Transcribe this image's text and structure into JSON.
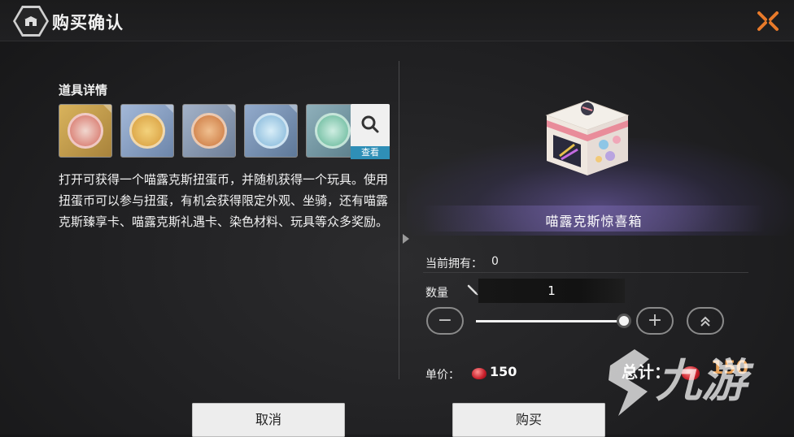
{
  "header": {
    "title": "购买确认",
    "close_icon": "close-x-icon",
    "badge_icon": "shop-icon"
  },
  "details": {
    "label": "道具详情",
    "items": [
      {
        "name": "red-token",
        "color": "#c9a04a",
        "inner": "#e07a6a"
      },
      {
        "name": "gold-coin",
        "color": "#8fa7c9",
        "inner": "#e4b24e"
      },
      {
        "name": "orange-coin",
        "color": "#8f9fb8",
        "inner": "#d69047"
      },
      {
        "name": "blue-coin",
        "color": "#7b96b8",
        "inner": "#8fc0e0"
      },
      {
        "name": "teal-coin",
        "color": "#7a9aa6",
        "inner": "#75c2a8"
      }
    ],
    "search_label": "查看",
    "description": "打开可获得一个喵露克斯扭蛋币，并随机获得一个玩具。使用扭蛋币可以参与扭蛋，有机会获得限定外观、坐骑，还有喵露克斯臻享卡、喵露克斯礼遇卡、染色材料、玩具等众多奖励。"
  },
  "product": {
    "name": "喵露克斯惊喜箱"
  },
  "purchase": {
    "owned_label": "当前拥有：",
    "owned_value": "0",
    "quantity_label": "数量",
    "quantity_value": "1",
    "quantity_fill": 1.0,
    "minus": "−",
    "plus": "+",
    "max": "︽",
    "unit_price_label": "单价：",
    "unit_price_value": "150",
    "total_label": "总计：",
    "total_value": "150"
  },
  "buttons": {
    "cancel": "取消",
    "buy": "购买"
  },
  "colors": {
    "accent_orange": "#e87a2a",
    "total_color": "#e9a35a",
    "search_blue": "#2f8fb7"
  },
  "watermark": {
    "text": "九游"
  }
}
